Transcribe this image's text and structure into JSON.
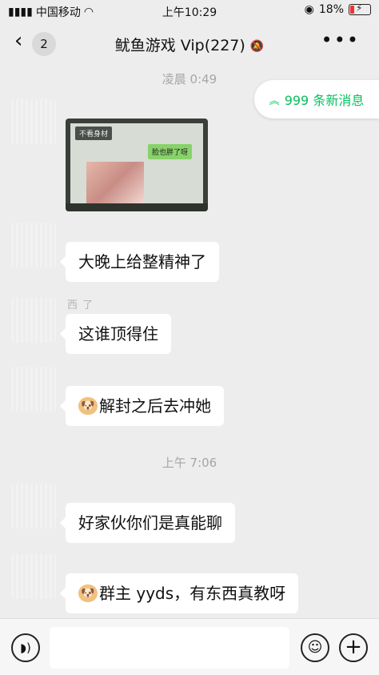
{
  "status_bar": {
    "carrier": "中国移动",
    "time": "上午10:29",
    "battery": "18%"
  },
  "header": {
    "back_badge": "2",
    "title": "鱿鱼游戏 Vip(227)"
  },
  "new_messages_pill": "999 条新消息",
  "separators": [
    "凌晨 0:49",
    "上午 7:06"
  ],
  "image_message": {
    "tag": "不看身材",
    "green_text": "脸也胖了呀"
  },
  "messages": [
    {
      "nick": "",
      "text": "大晚上给整精神了",
      "emoji": false
    },
    {
      "nick": "西 了",
      "text": "这谁顶得住",
      "emoji": false
    },
    {
      "nick": "",
      "text": "解封之后去冲她",
      "emoji": true
    },
    {
      "nick": "",
      "text": "好家伙你们是真能聊",
      "emoji": false
    },
    {
      "nick": "",
      "text": "群主 yyds，有东西真教呀",
      "emoji": true
    }
  ]
}
